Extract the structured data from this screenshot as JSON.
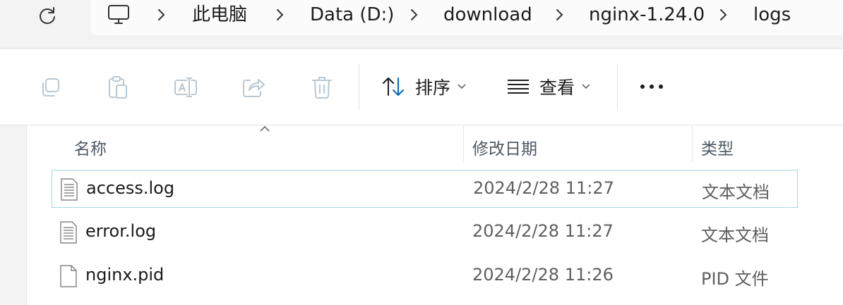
{
  "address_bar": {
    "crumbs": [
      "此电脑",
      "Data (D:)",
      "download",
      "nginx-1.24.0",
      "logs"
    ]
  },
  "command_bar": {
    "sort_label": "排序",
    "view_label": "查看",
    "more_label": "•••"
  },
  "file_list": {
    "columns": {
      "name": "名称",
      "modified": "修改日期",
      "type": "类型"
    },
    "rows": [
      {
        "name": "access.log",
        "modified": "2024/2/28 11:27",
        "type": "文本文档",
        "icon": "text-file-icon"
      },
      {
        "name": "error.log",
        "modified": "2024/2/28 11:27",
        "type": "文本文档",
        "icon": "text-file-icon"
      },
      {
        "name": "nginx.pid",
        "modified": "2024/2/28 11:26",
        "type": "PID 文件",
        "icon": "blank-file-icon"
      }
    ]
  },
  "colors": {
    "selection_border": "#a6d4e6",
    "toolbar_disabled": "#b9c7d3",
    "accent": "#0067c0"
  }
}
